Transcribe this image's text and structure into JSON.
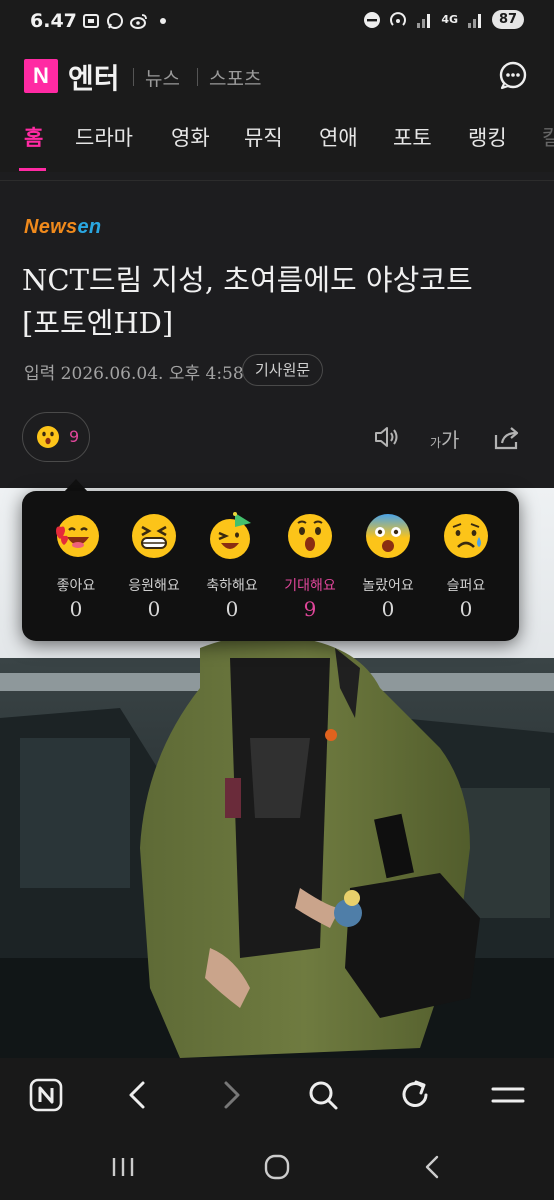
{
  "status_bar": {
    "time": "6.47",
    "left_icons": [
      "screenshot-icon",
      "whatsapp-icon",
      "weibo-icon",
      "dot-icon"
    ],
    "right_icons": [
      "do-not-disturb-icon",
      "hotspot-icon",
      "signal-icon",
      "4g-icon",
      "signal-icon"
    ],
    "network": "4G",
    "battery": "87"
  },
  "header": {
    "logo_letter": "N",
    "logo_text": "엔터",
    "links": [
      "뉴스",
      "스포츠"
    ],
    "chat_icon": "chat-bubble-icon"
  },
  "tabs": [
    {
      "label": "홈",
      "active": true
    },
    {
      "label": "드라마",
      "active": false
    },
    {
      "label": "영화",
      "active": false
    },
    {
      "label": "뮤직",
      "active": false
    },
    {
      "label": "연애",
      "active": false
    },
    {
      "label": "포토",
      "active": false
    },
    {
      "label": "랭킹",
      "active": false
    },
    {
      "label": "칼",
      "active": false
    }
  ],
  "article": {
    "source_part1": "News",
    "source_part2": "en",
    "title_line1": "NCT드림 지성, 초여름에도 야상코트",
    "title_line2": "[포토엔HD]",
    "meta": "입력 2026.06.04. 오후 4:58",
    "original_button": "기사원문",
    "reaction_count": "9",
    "font_small": "가",
    "font_large": "가"
  },
  "reactions": [
    {
      "label": "좋아요",
      "count": "0",
      "icon": "love-emoji-icon",
      "selected": false
    },
    {
      "label": "응원해요",
      "count": "0",
      "icon": "cheer-emoji-icon",
      "selected": false
    },
    {
      "label": "축하해요",
      "count": "0",
      "icon": "party-emoji-icon",
      "selected": false
    },
    {
      "label": "기대해요",
      "count": "9",
      "icon": "surprised-emoji-icon",
      "selected": true
    },
    {
      "label": "놀랐어요",
      "count": "0",
      "icon": "shocked-emoji-icon",
      "selected": false
    },
    {
      "label": "슬퍼요",
      "count": "0",
      "icon": "sad-emoji-icon",
      "selected": false
    }
  ],
  "colors": {
    "accent": "#ff2aa3",
    "selected_reaction": "#e0469a",
    "background": "#1d1d1f"
  }
}
